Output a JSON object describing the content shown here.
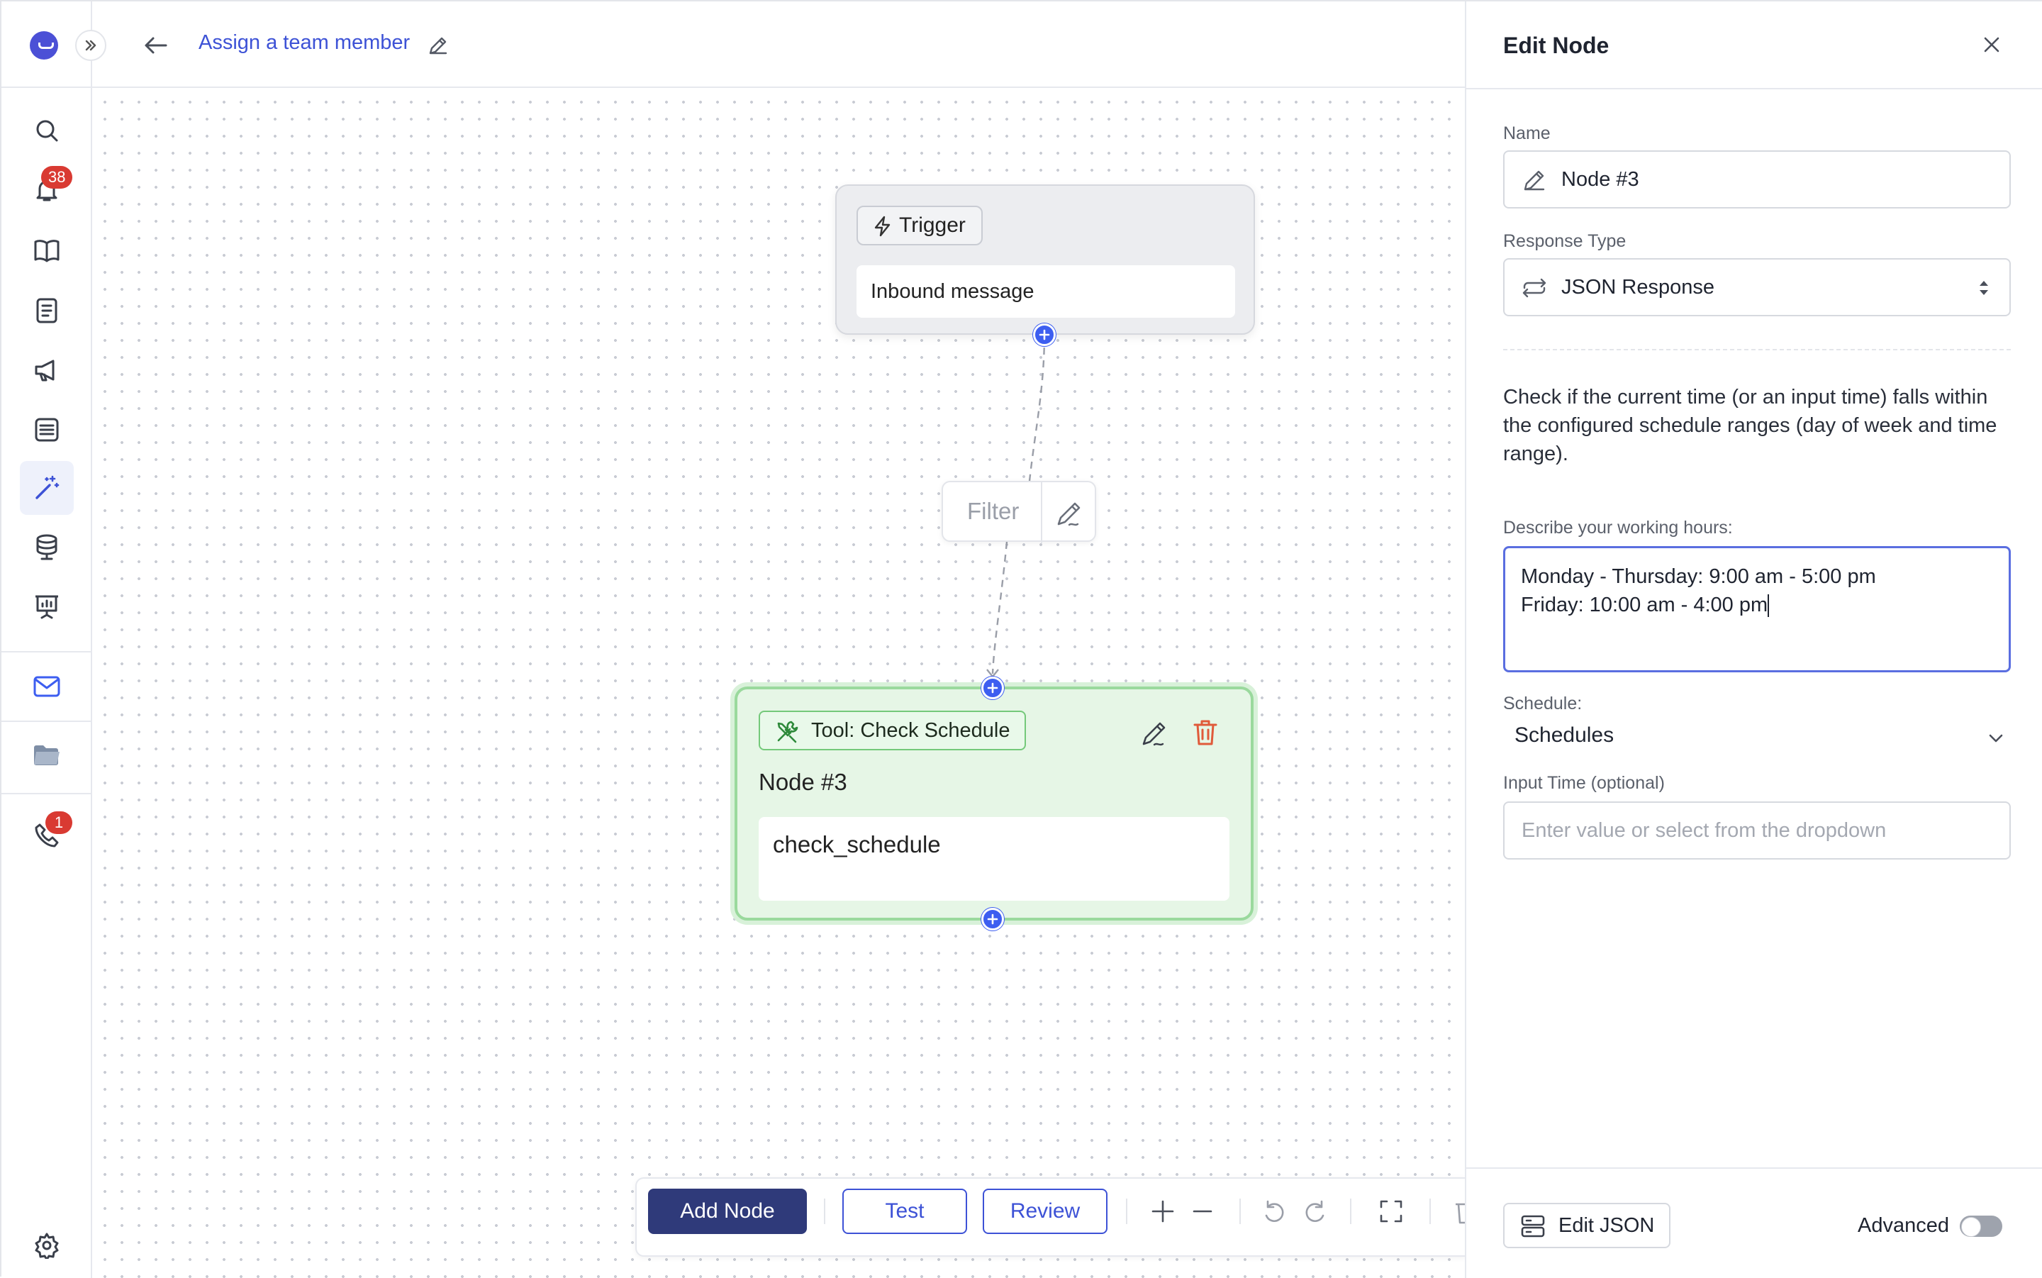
{
  "sidebar": {
    "notifications_count": "38",
    "phone_count": "1",
    "icons": [
      "search-icon",
      "bell-icon",
      "book-icon",
      "document-icon",
      "megaphone-icon",
      "list-icon",
      "magic-wand-icon",
      "database-icon",
      "presentation-icon",
      "mail-icon",
      "folder-icon",
      "phone-icon",
      "settings-icon"
    ]
  },
  "topbar": {
    "workflow_title": "Assign a team member"
  },
  "canvas": {
    "trigger_node": {
      "chip_label": "Trigger",
      "message": "Inbound message"
    },
    "filter": {
      "label": "Filter"
    },
    "tool_node": {
      "chip_label": "Tool: Check Schedule",
      "name": "Node #3",
      "function": "check_schedule"
    }
  },
  "toolbar": {
    "add_node": "Add Node",
    "test": "Test",
    "review": "Review"
  },
  "panel": {
    "title": "Edit Node",
    "name_label": "Name",
    "name_value": "Node #3",
    "response_type_label": "Response Type",
    "response_type_value": "JSON Response",
    "description": "Check if the current time (or an input time) falls within the configured schedule ranges (day of week and time range).",
    "working_hours_label": "Describe your working hours:",
    "working_hours_line1": "Monday - Thursday: 9:00 am - 5:00 pm",
    "working_hours_line2": "Friday: 10:00 am - 4:00 pm",
    "schedule_label": "Schedule:",
    "schedule_value": "Schedules",
    "input_time_label": "Input Time (optional)",
    "input_time_placeholder": "Enter value or select from the dropdown",
    "edit_json": "Edit JSON",
    "advanced_label": "Advanced",
    "advanced_enabled": false
  },
  "colors": {
    "accent": "#3d52d6",
    "primary_button": "#2f3a7a",
    "tool_node_bg": "#e6f6e6",
    "tool_node_border": "#9ad99d",
    "badge": "#d93a32",
    "delete": "#e05a3a"
  }
}
